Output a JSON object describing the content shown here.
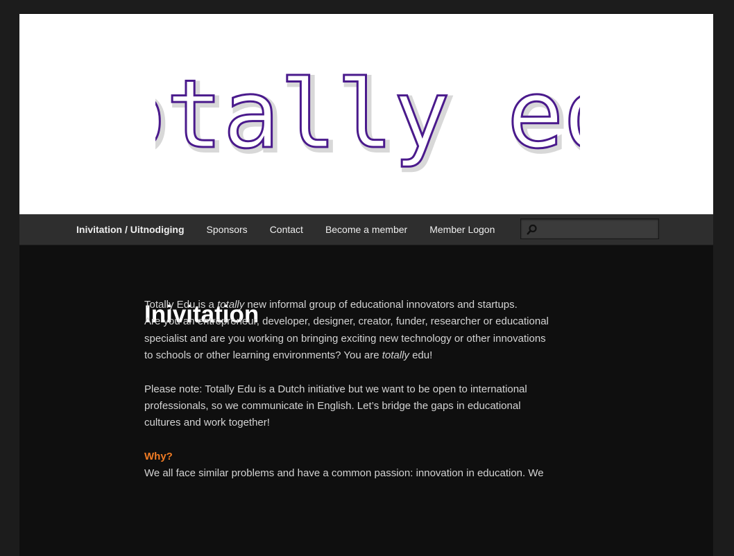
{
  "site": {
    "logo_text": "totally edu",
    "colors": {
      "logo_stroke": "#4a1a8c",
      "logo_fill": "#ffffff",
      "heading_accent": "#ef7b24",
      "background": "#0f0f0f",
      "nav_bg": "#2e2e2e"
    }
  },
  "nav": {
    "items": [
      {
        "label": "Inivitation / Uitnodiging",
        "active": true
      },
      {
        "label": "Sponsors"
      },
      {
        "label": "Contact"
      },
      {
        "label": "Become a member"
      },
      {
        "label": "Member Logon"
      }
    ],
    "search": {
      "placeholder": "",
      "value": "",
      "icon": "search-icon"
    }
  },
  "main": {
    "title": "Inivitation",
    "intro": {
      "line1_pre": "Totally Edu is a ",
      "line1_em": "totally",
      "line1_post": " new informal group of educational innovators and startups.",
      "line2_pre": "Are you an entrepreneur, developer, designer, creator, funder, researcher or educational specialist and are you working on bringing exciting new technology or other innovations to schools or other learning environments? You are ",
      "line2_em": "totally",
      "line2_post": " edu!"
    },
    "note": "Please note: Totally Edu is a Dutch initiative but we want to be open to international professionals, so we communicate in English. Let’s bridge the gaps in educational cultures and work together!",
    "why": {
      "heading": "Why?",
      "text": "We all face similar problems and have a common passion: innovation in education. We"
    }
  }
}
